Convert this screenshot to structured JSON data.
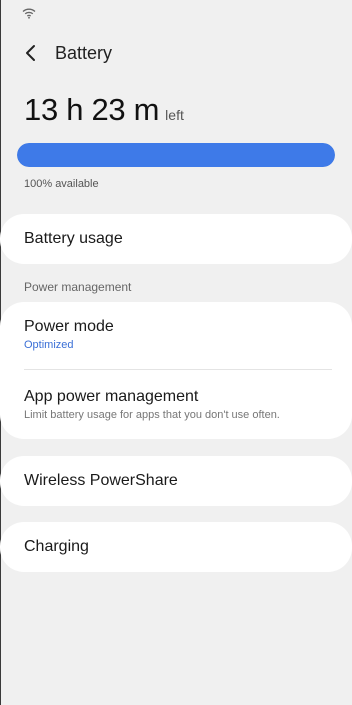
{
  "app_bar": {
    "title": "Battery",
    "back_icon": "back-arrow-icon"
  },
  "status_bar": {
    "icons": [
      "wifi-icon"
    ]
  },
  "battery": {
    "remaining_time": "13 h 23 m",
    "remaining_suffix": "left",
    "level_fraction": 1.0,
    "available_text": "100% available",
    "bar_color": "#3e7ae8"
  },
  "items": {
    "battery_usage": "Battery usage",
    "section_header": "Power management",
    "power_mode": {
      "title": "Power mode",
      "subtitle": "Optimized"
    },
    "app_power_management": {
      "title": "App power management",
      "subtitle": "Limit battery usage for apps that you don't use often."
    },
    "wireless_powershare": "Wireless PowerShare",
    "charging": "Charging"
  },
  "colors": {
    "background": "#f0f0f0",
    "card": "#ffffff",
    "accent_blue": "#3a6fd6"
  }
}
